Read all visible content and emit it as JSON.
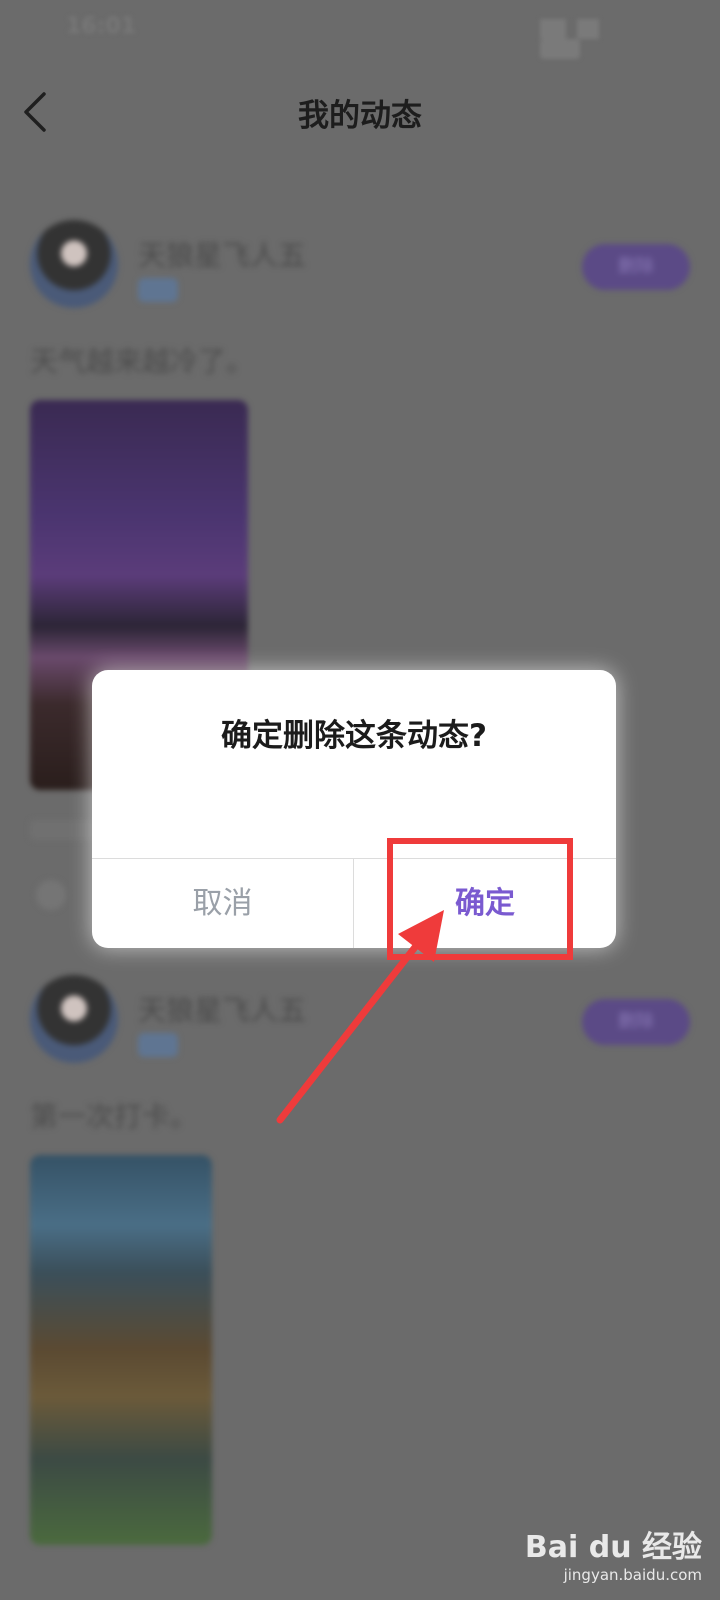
{
  "status_bar": {
    "time": "16:01"
  },
  "header": {
    "title": "我的动态"
  },
  "feed": {
    "posts": [
      {
        "user_name": "天狼星飞人五",
        "badge": "删除",
        "text": "天气越来越冷了。"
      },
      {
        "user_name": "天狼星飞人五",
        "badge": "删除",
        "text": "第一次打卡。"
      }
    ]
  },
  "dialog": {
    "title": "确定删除这条动态?",
    "cancel_label": "取消",
    "confirm_label": "确定"
  },
  "watermark": {
    "logo": "Bai du 经验",
    "url": "jingyan.baidu.com"
  },
  "colors": {
    "accent": "#7a5ad0",
    "annotation": "#ef3b3b",
    "overlay": "#6b6b6b"
  }
}
